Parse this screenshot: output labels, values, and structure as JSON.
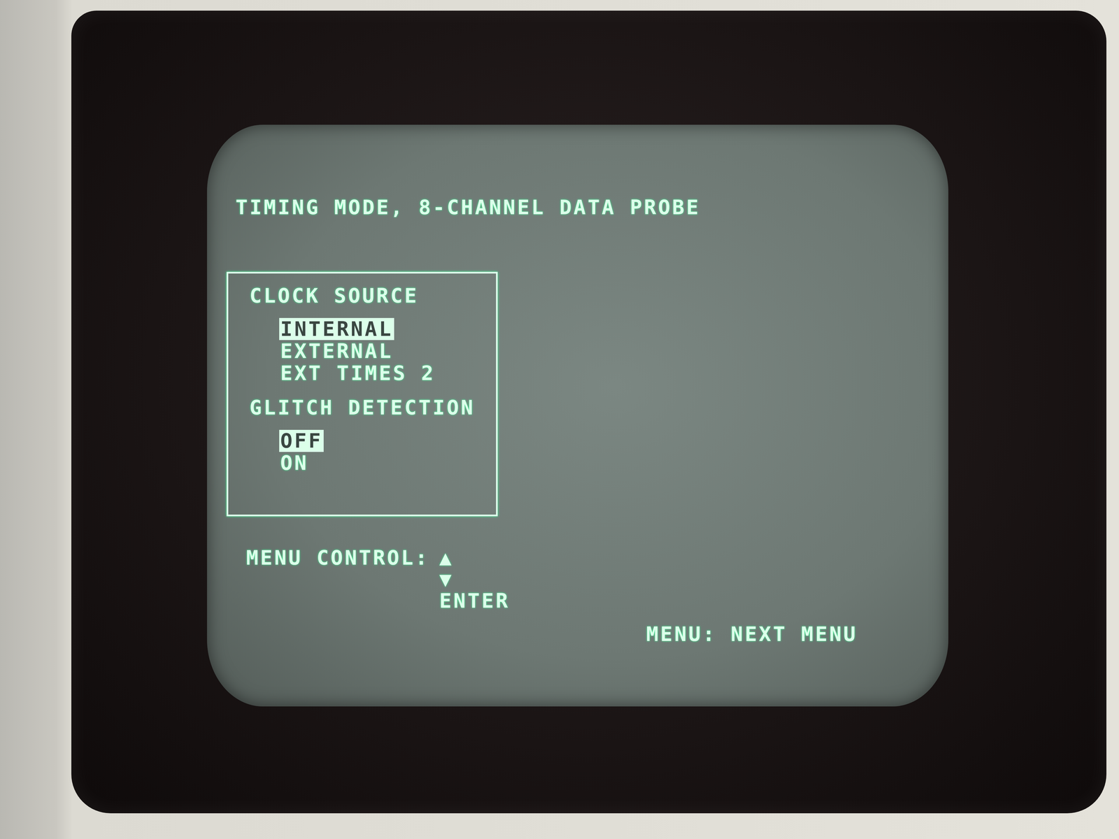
{
  "title": "TIMING MODE, 8-CHANNEL DATA PROBE",
  "menu_box": {
    "sections": [
      {
        "heading": "CLOCK SOURCE",
        "options": [
          {
            "label": "INTERNAL",
            "selected": true
          },
          {
            "label": "EXTERNAL",
            "selected": false
          },
          {
            "label": "EXT TIMES 2",
            "selected": false
          }
        ]
      },
      {
        "heading": "GLITCH DETECTION",
        "options": [
          {
            "label": "OFF",
            "selected": true
          },
          {
            "label": "ON",
            "selected": false
          }
        ]
      }
    ]
  },
  "menu_control": {
    "label": "MENU CONTROL:",
    "keys": [
      "▲",
      "▼",
      "ENTER"
    ]
  },
  "hint": "MENU: NEXT MENU"
}
